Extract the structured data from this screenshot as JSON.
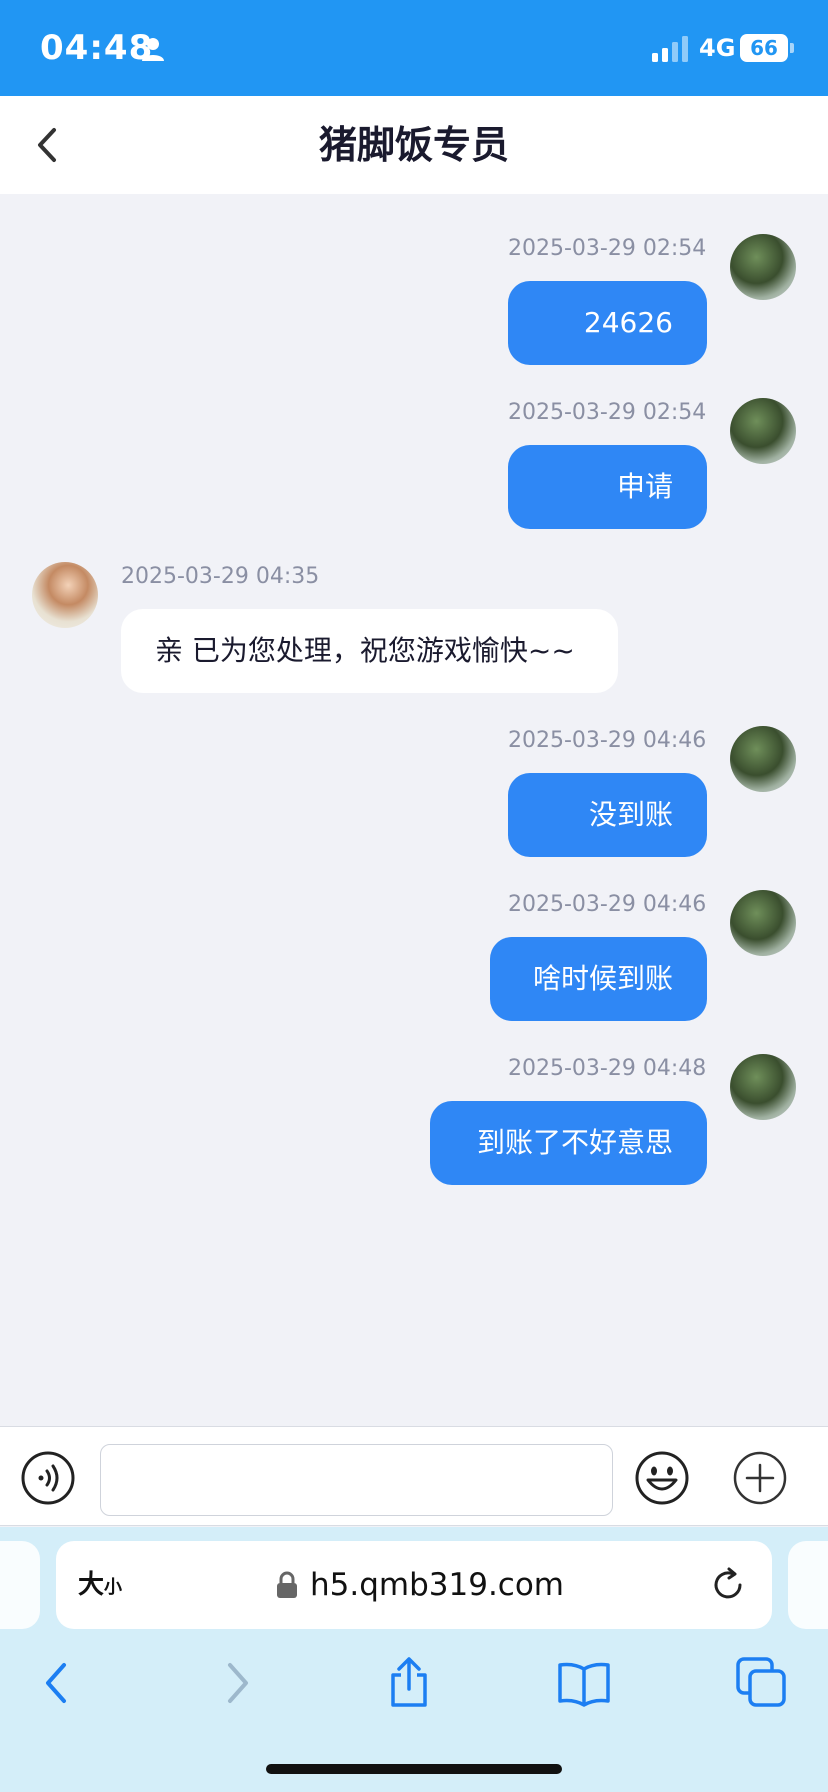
{
  "status_bar": {
    "time": "04:48",
    "network": "4G",
    "battery": "66"
  },
  "header": {
    "title": "猪脚饭专员"
  },
  "messages": [
    {
      "sender": "me",
      "time": "2025-03-29 02:54",
      "text": "24626"
    },
    {
      "sender": "me",
      "time": "2025-03-29 02:54",
      "text": "申请"
    },
    {
      "sender": "agent",
      "time": "2025-03-29 04:35",
      "text": "亲 已为您处理，祝您游戏愉快~~"
    },
    {
      "sender": "me",
      "time": "2025-03-29 04:46",
      "text": "没到账"
    },
    {
      "sender": "me",
      "time": "2025-03-29 04:46",
      "text": "啥时候到账"
    },
    {
      "sender": "me",
      "time": "2025-03-29 04:48",
      "text": "到账了不好意思"
    }
  ],
  "input_bar": {
    "message_value": "",
    "icons": [
      "voice-icon",
      "emoji-icon",
      "plus-icon"
    ]
  },
  "browser": {
    "text_size_label": "大",
    "text_size_label_small": "小",
    "url": "h5.qmb319.com",
    "toolbar_icons": [
      "back-icon",
      "forward-icon",
      "share-icon",
      "bookmarks-icon",
      "tabs-icon"
    ]
  },
  "colors": {
    "status_bar": "#2196f3",
    "my_bubble": "#2f87f5",
    "chat_background": "#f1f2f7",
    "browser_chrome": "#d4eef9"
  }
}
